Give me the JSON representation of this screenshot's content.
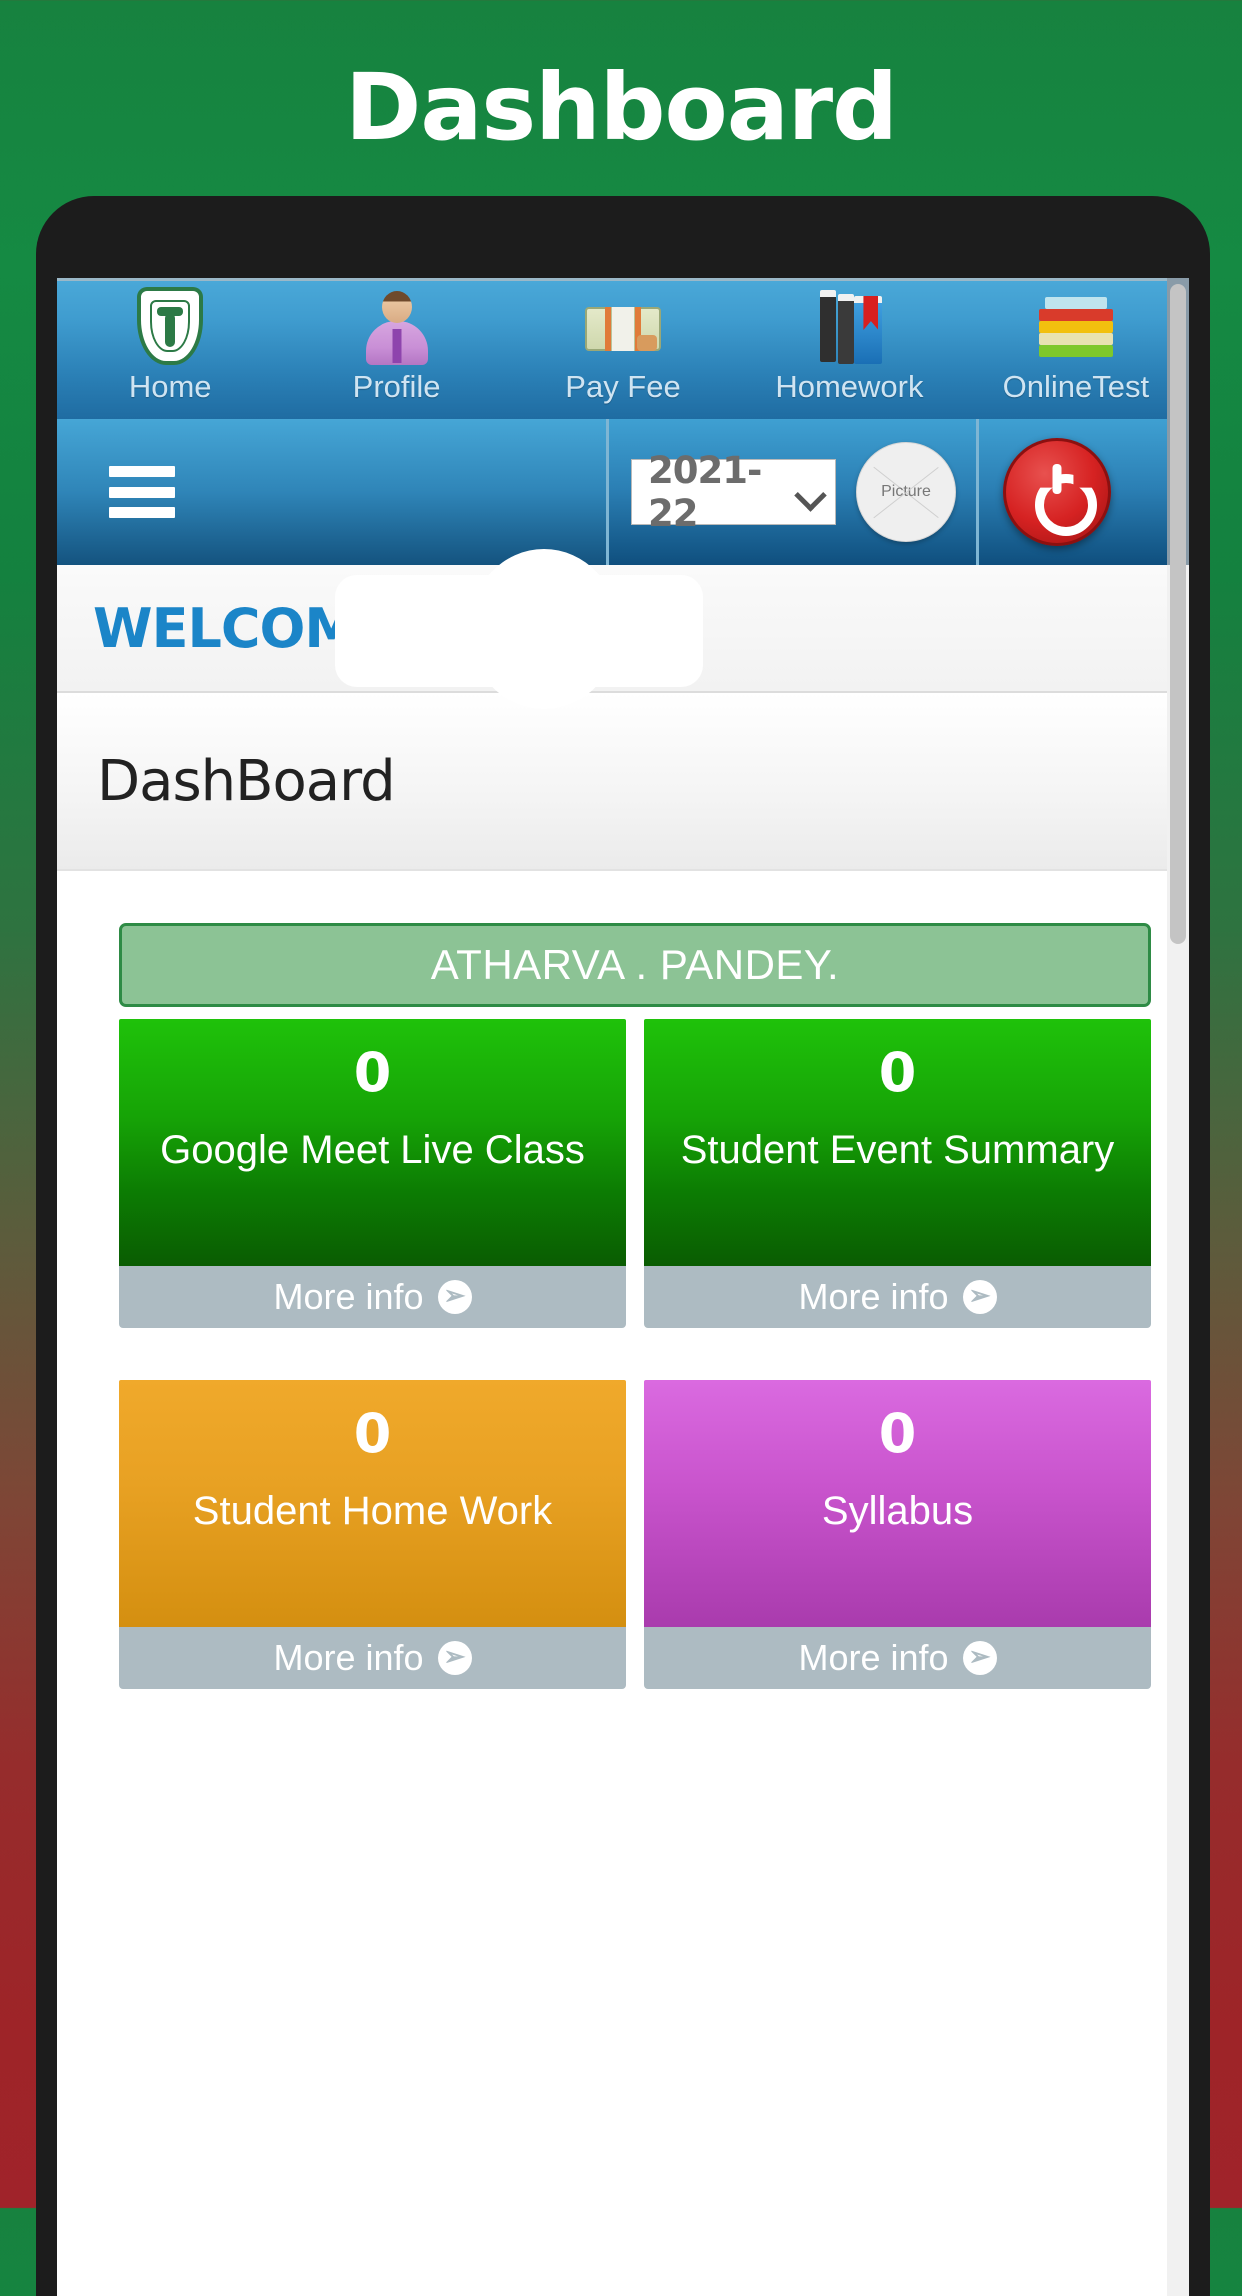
{
  "page": {
    "title": "Dashboard"
  },
  "app": {
    "icon_nav": {
      "items": [
        {
          "label": "Home",
          "icon": "school-crest-icon"
        },
        {
          "label": "Profile",
          "icon": "person-avatar-icon"
        },
        {
          "label": "Pay Fee",
          "icon": "cash-money-icon"
        },
        {
          "label": "Homework",
          "icon": "books-bookmark-icon"
        },
        {
          "label": "OnlineTest",
          "icon": "book-stack-icon"
        }
      ]
    },
    "toolbar": {
      "menu_icon": "hamburger-menu-icon",
      "session_select": {
        "value": "2021-22",
        "chevron_icon": "chevron-down-icon"
      },
      "avatar": {
        "label": "Picture",
        "icon": "broken-image-placeholder-icon"
      },
      "logout": {
        "icon": "power-off-icon"
      }
    },
    "welcome": {
      "text": "WELCOME",
      "name": ""
    },
    "heading": {
      "text": "DashBoard"
    },
    "student": {
      "name": "ATHARVA . PANDEY."
    },
    "tiles": [
      {
        "count": "0",
        "label": "Google Meet Live Class",
        "more_info": "More info",
        "color": "#16a306",
        "arrow_icon": "arrow-right-circle-icon"
      },
      {
        "count": "0",
        "label": "Student Event Summary",
        "more_info": "More info",
        "color": "#16a306",
        "arrow_icon": "arrow-right-circle-icon"
      },
      {
        "count": "0",
        "label": "Student Home Work",
        "more_info": "More info",
        "color": "#e8a123",
        "arrow_icon": "arrow-right-circle-icon"
      },
      {
        "count": "0",
        "label": "Syllabus",
        "more_info": "More info",
        "color": "#c853cc",
        "arrow_icon": "arrow-right-circle-icon"
      }
    ]
  }
}
